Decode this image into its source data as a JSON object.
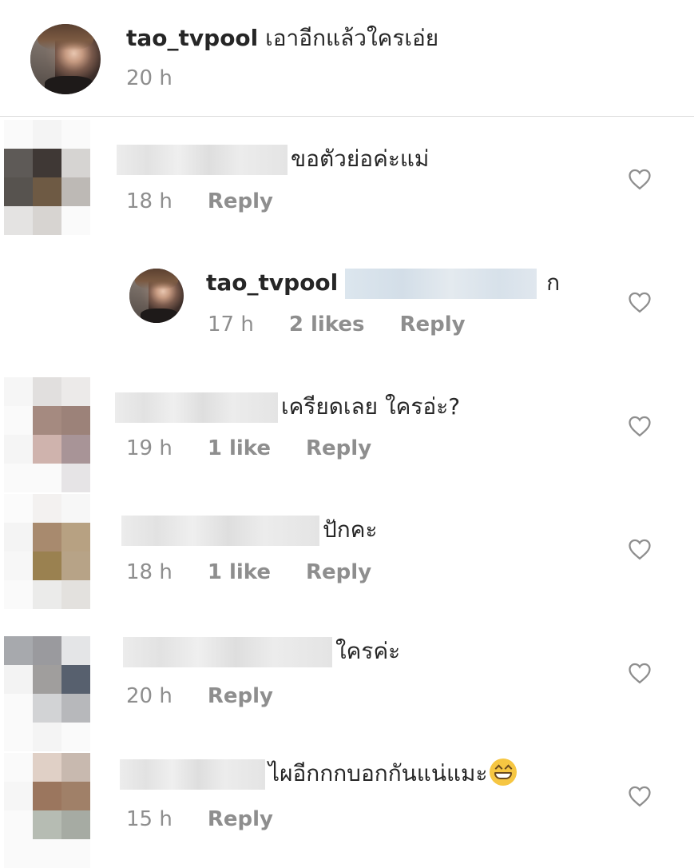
{
  "caption": {
    "username": "tao_tvpool",
    "text": "เอาอีกแล้วใครเอ่ย",
    "time": "20 h"
  },
  "comments": [
    {
      "text": "ขอตัวย่อค่ะแม่",
      "time": "18 h",
      "likes": "",
      "reply_label": "Reply"
    },
    {
      "username": "tao_tvpool",
      "text": "ก",
      "time": "17 h",
      "likes": "2 likes",
      "reply_label": "Reply"
    },
    {
      "text": "เครียดเลย ใครอ่ะ?",
      "time": "19 h",
      "likes": "1 like",
      "reply_label": "Reply"
    },
    {
      "text": "ปักคะ",
      "time": "18 h",
      "likes": "1 like",
      "reply_label": "Reply"
    },
    {
      "text": "ใครค่ะ",
      "time": "20 h",
      "likes": "",
      "reply_label": "Reply"
    },
    {
      "text": "ไผอีกกกบอกกันแน่แมะ",
      "time": "15 h",
      "likes": "",
      "reply_label": "Reply",
      "emoji": "grinning-face-with-smiling-eyes"
    }
  ],
  "icons": {
    "like": "heart-outline-icon"
  },
  "colors": {
    "text": "#262626",
    "meta": "#8e8e8e",
    "divider": "#dbdbdb"
  }
}
